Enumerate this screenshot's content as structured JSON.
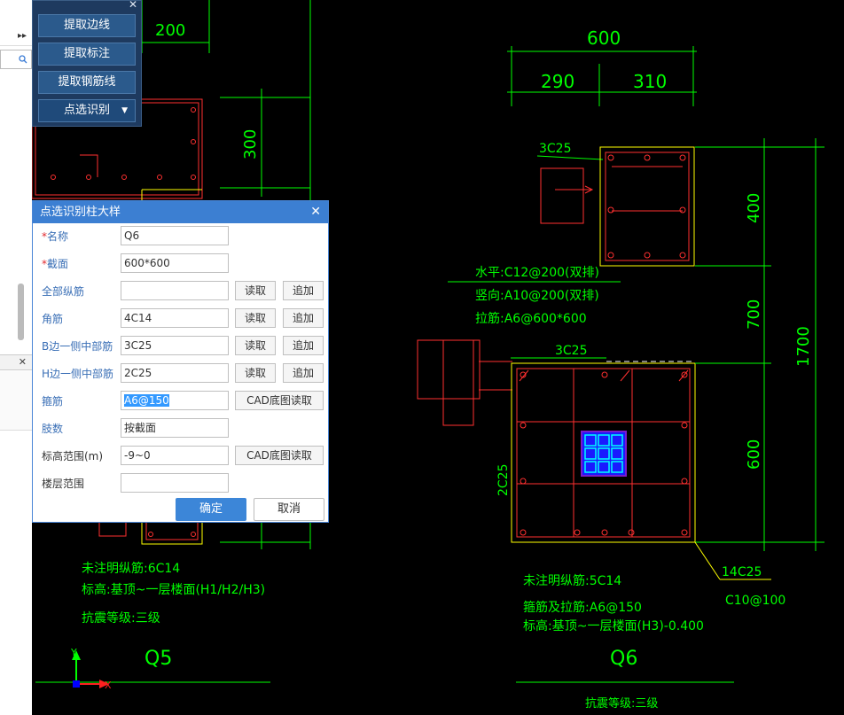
{
  "toolbar_panel": {
    "buttons": [
      "提取边线",
      "提取标注",
      "提取钢筋线",
      "点选识别"
    ]
  },
  "dialog": {
    "title": "点选识别柱大样",
    "fields": [
      {
        "label": "名称",
        "required": true,
        "value": "Q6"
      },
      {
        "label": "截面",
        "required": true,
        "value": "600*600"
      },
      {
        "label": "全部纵筋",
        "value": "",
        "btn1": "读取",
        "btn2": "追加"
      },
      {
        "label": "角筋",
        "value": "4C14",
        "btn1": "读取",
        "btn2": "追加"
      },
      {
        "label": "B边一侧中部筋",
        "value": "3C25",
        "btn1": "读取",
        "btn2": "追加"
      },
      {
        "label": "H边一侧中部筋",
        "value": "2C25",
        "btn1": "读取",
        "btn2": "追加"
      },
      {
        "label": "箍筋",
        "value": "A6@150",
        "btn": "CAD底图读取"
      },
      {
        "label": "肢数",
        "value": "按截面"
      },
      {
        "label": "标高范围(m)",
        "value": "-9~0",
        "btn": "CAD底图读取"
      },
      {
        "label": "楼层范围",
        "value": ""
      }
    ],
    "ok": "确定",
    "cancel": "取消"
  },
  "drawing": {
    "left_col": {
      "dim_top": "200",
      "dim_right": "300",
      "notes": [
        "未注明纵筋:6C14",
        "标高:基顶~一层楼面(H1/H2/H3)",
        "抗震等级:三级"
      ],
      "name": "Q5"
    },
    "right_top": {
      "dim_total": "600",
      "dim_a": "290",
      "dim_b": "310",
      "rebar": "3C25",
      "notes": [
        "水平:C12@200(双排)",
        "竖向:A10@200(双排)",
        "拉筋:A6@600*600"
      ]
    },
    "right_main": {
      "top_rebar": "3C25",
      "side_rebar": "2C25",
      "dim_right": [
        "400",
        "700",
        "600"
      ],
      "dim_total": "1700",
      "leader": [
        "14C25",
        "C10@100"
      ],
      "notes": [
        "未注明纵筋:5C14",
        "箍筋及拉筋:A6@150",
        "标高:基顶~一层楼面(H3)-0.400"
      ],
      "name": "Q6",
      "grade": "抗震等级:三级"
    },
    "axes": {
      "x": "X",
      "y": "Y"
    },
    "colors": {
      "bg": "#000000",
      "dim": "#00ff00",
      "rebar": "#ff3030",
      "outline": "#ffff66",
      "hatch": "#0000ff"
    }
  },
  "left_strip": {
    "arrows": "▸▸",
    "search_icon": "search-icon",
    "close": "✕"
  }
}
